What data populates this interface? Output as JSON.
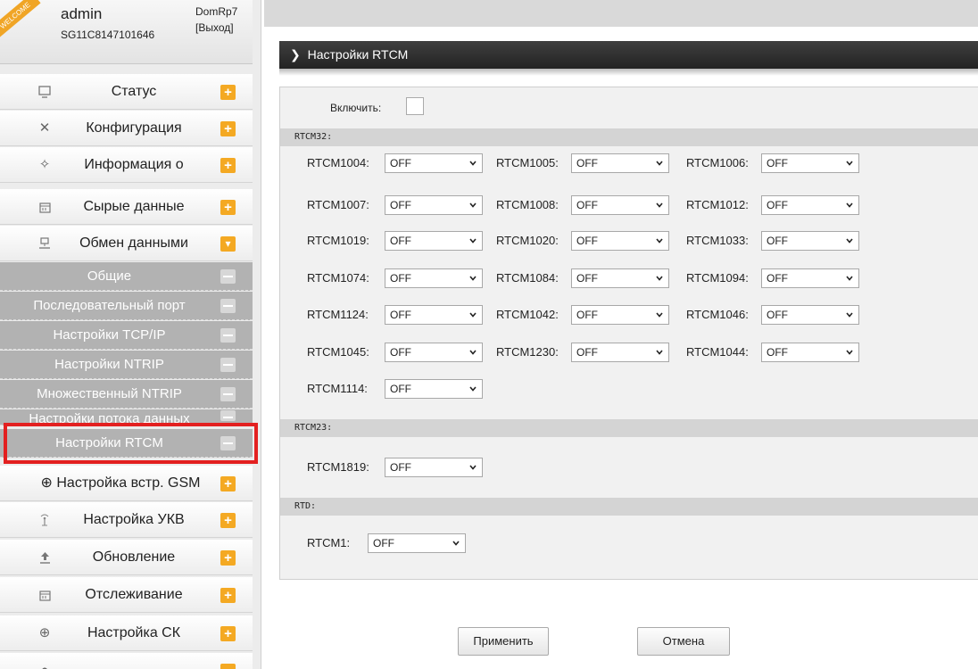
{
  "user": {
    "welcome": "WELCOME",
    "name": "admin",
    "serial": "SG11C8147101646",
    "device": "DomRp7",
    "logout": "[Выход]"
  },
  "sidebar": {
    "menu_top": [
      {
        "label": "Статус",
        "icon": "monitor-icon",
        "button": "+"
      },
      {
        "label": "Конфигурация",
        "icon": "tools-icon",
        "button": "+"
      },
      {
        "label": "Информация о",
        "icon": "satellite-icon",
        "button": "+"
      },
      {
        "label": "Сырые данные",
        "icon": "calendar-icon",
        "button": "+"
      },
      {
        "label": "Обмен данными",
        "icon": "network-icon",
        "button": "▾"
      }
    ],
    "submenu": [
      {
        "label": "Общие"
      },
      {
        "label": "Последовательный порт"
      },
      {
        "label": "Настройки TCP/IP"
      },
      {
        "label": "Настройки NTRIP"
      },
      {
        "label": "Множественный NTRIP"
      },
      {
        "label": "Настройки потока данных"
      },
      {
        "label": "Настройки RTCM"
      }
    ],
    "menu_bottom": [
      {
        "label": "⊕ Настройка встр. GSM",
        "icon": "",
        "button": "+"
      },
      {
        "label": "Настройка УКВ",
        "icon": "radio-antenna-icon",
        "button": "+"
      },
      {
        "label": "Обновление",
        "icon": "upload-icon",
        "button": "+"
      },
      {
        "label": "Отслеживание",
        "icon": "calendar-icon",
        "button": "+"
      },
      {
        "label": "Настройка СК",
        "icon": "globe-icon",
        "button": "+"
      }
    ],
    "colors": {
      "plus_button": "#f4a923",
      "submenu_bg": "#b2b2b2",
      "highlight": "#e32020"
    }
  },
  "page": {
    "title": "Настройки RTCM",
    "enable_label": "Включить:",
    "enable_checked": false
  },
  "sections": [
    {
      "title": "RTCM32:",
      "fields": [
        {
          "label": "RTCM1004:",
          "value": "OFF"
        },
        {
          "label": "RTCM1005:",
          "value": "OFF"
        },
        {
          "label": "RTCM1006:",
          "value": "OFF"
        },
        {
          "label": "RTCM1007:",
          "value": "OFF"
        },
        {
          "label": "RTCM1008:",
          "value": "OFF"
        },
        {
          "label": "RTCM1012:",
          "value": "OFF"
        },
        {
          "label": "RTCM1019:",
          "value": "OFF"
        },
        {
          "label": "RTCM1020:",
          "value": "OFF"
        },
        {
          "label": "RTCM1033:",
          "value": "OFF"
        },
        {
          "label": "RTCM1074:",
          "value": "OFF"
        },
        {
          "label": "RTCM1084:",
          "value": "OFF"
        },
        {
          "label": "RTCM1094:",
          "value": "OFF"
        },
        {
          "label": "RTCM1124:",
          "value": "OFF"
        },
        {
          "label": "RTCM1042:",
          "value": "OFF"
        },
        {
          "label": "RTCM1046:",
          "value": "OFF"
        },
        {
          "label": "RTCM1045:",
          "value": "OFF"
        },
        {
          "label": "RTCM1230:",
          "value": "OFF"
        },
        {
          "label": "RTCM1044:",
          "value": "OFF"
        },
        {
          "label": "RTCM1114:",
          "value": "OFF"
        }
      ]
    },
    {
      "title": "RTCM23:",
      "fields": [
        {
          "label": "RTCM1819:",
          "value": "OFF"
        }
      ]
    },
    {
      "title": "RTD:",
      "fields": [
        {
          "label": "RTCM1:",
          "value": "OFF"
        }
      ]
    }
  ],
  "buttons": {
    "apply": "Применить",
    "cancel": "Отмена"
  }
}
